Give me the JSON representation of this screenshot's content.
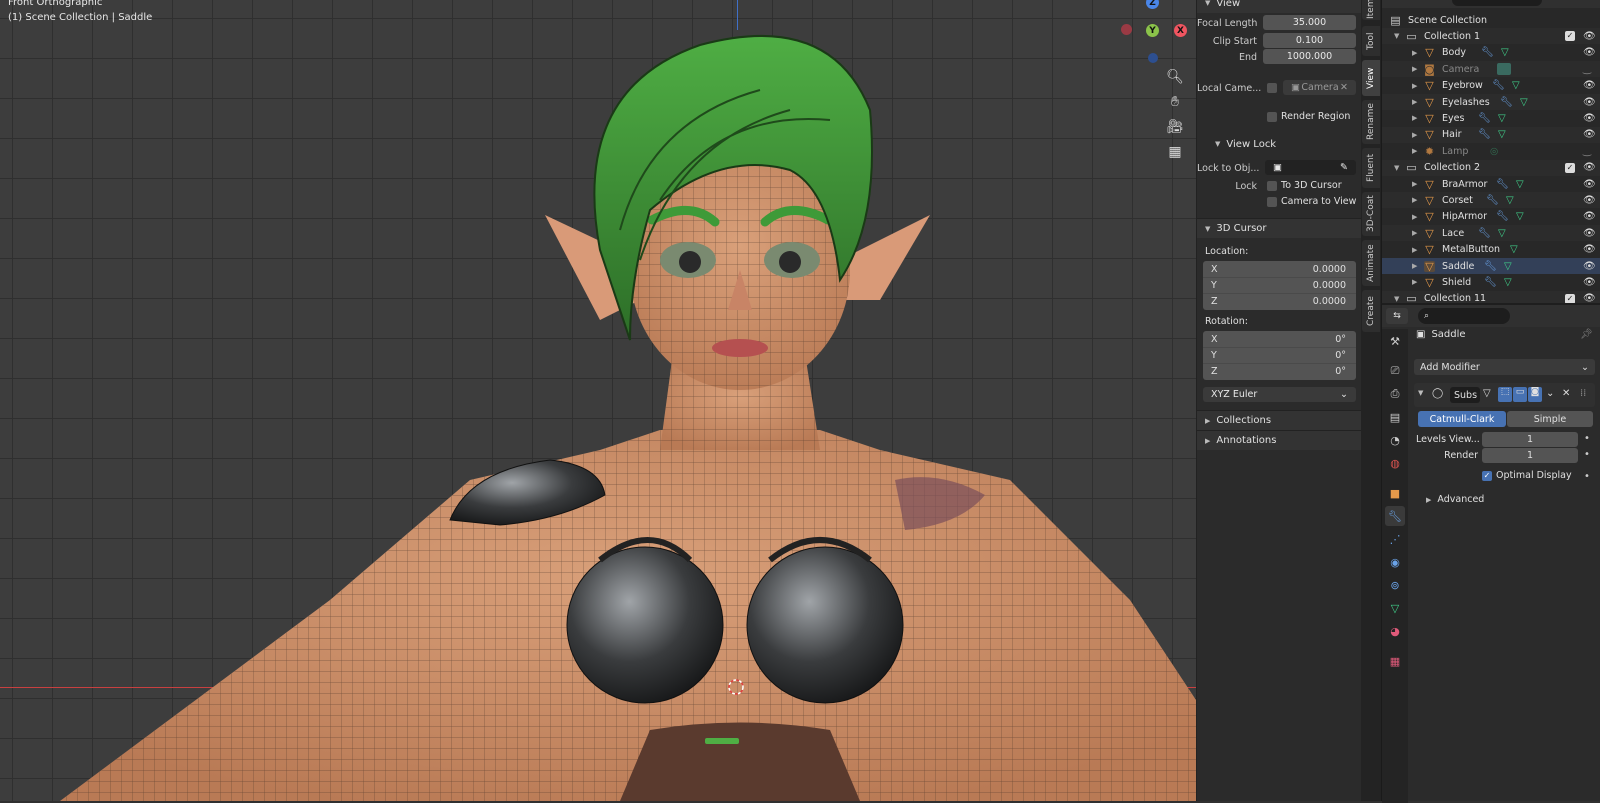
{
  "viewport": {
    "view_name": "Front Orthographic",
    "context": "(1) Scene Collection | Saddle",
    "gizmo": {
      "z": "Z",
      "y": "Y",
      "x": "X"
    }
  },
  "sidebar_tabs": [
    "Item",
    "Tool",
    "View",
    "Rename",
    "Fluent",
    "3D-Coat",
    "Animate",
    "Create"
  ],
  "view_panel": {
    "header": "View",
    "focal_length_label": "Focal Length",
    "focal_length": "35.000",
    "clip_start_label": "Clip Start",
    "clip_start": "0.100",
    "end_label": "End",
    "end": "1000.000",
    "local_camera_label": "Local Came...",
    "local_camera_value": "Camera",
    "render_region": "Render Region",
    "view_lock_header": "View Lock",
    "lock_to_obj_label": "Lock to Obj...",
    "lock_label": "Lock",
    "to_3d_cursor": "To 3D Cursor",
    "camera_to_view": "Camera to View"
  },
  "cursor_panel": {
    "header": "3D Cursor",
    "location_label": "Location:",
    "loc": [
      {
        "axis": "X",
        "value": "0.0000"
      },
      {
        "axis": "Y",
        "value": "0.0000"
      },
      {
        "axis": "Z",
        "value": "0.0000"
      }
    ],
    "rotation_label": "Rotation:",
    "rot": [
      {
        "axis": "X",
        "value": "0°"
      },
      {
        "axis": "Y",
        "value": "0°"
      },
      {
        "axis": "Z",
        "value": "0°"
      }
    ],
    "rotation_mode": "XYZ Euler"
  },
  "collapsed_panels": [
    "Collections",
    "Annotations"
  ],
  "outliner": {
    "root": "Scene Collection",
    "collection1": "Collection 1",
    "items1": [
      "Body",
      "Camera",
      "Eyebrow",
      "Eyelashes",
      "Eyes",
      "Hair",
      "Lamp"
    ],
    "collection2": "Collection 2",
    "items2": [
      "BraArmor",
      "Corset",
      "HipArmor",
      "Lace",
      "MetalButton",
      "Saddle",
      "Shield"
    ],
    "collection3": "Collection 11"
  },
  "properties": {
    "object_name": "Saddle",
    "add_modifier": "Add Modifier",
    "modifier_name": "Subs",
    "catmull_clark": "Catmull-Clark",
    "simple": "Simple",
    "levels_viewport_label": "Levels View...",
    "levels_viewport": "1",
    "render_label": "Render",
    "render_value": "1",
    "optimal_display": "Optimal Display",
    "advanced": "Advanced"
  },
  "colors": {
    "accent": "#4772b3",
    "object_orange": "#e69a4a",
    "mesh_green": "#3fd08a",
    "modifier_blue": "#6aa3e8"
  }
}
